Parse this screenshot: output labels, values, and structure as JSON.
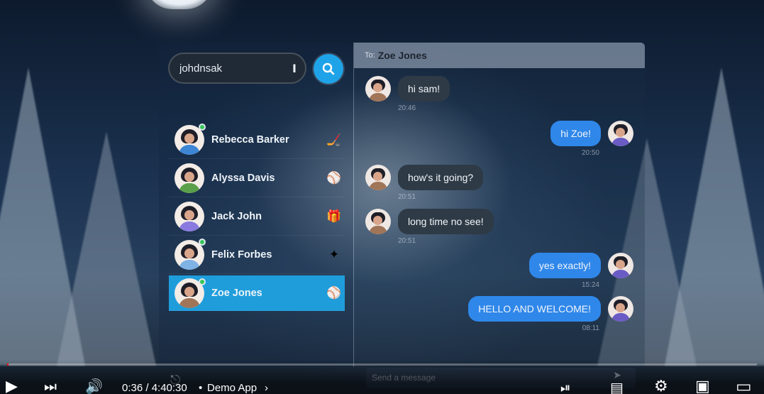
{
  "search": {
    "value": "johdnsak"
  },
  "contacts": [
    {
      "name": "Rebecca Barker",
      "online": true,
      "icon": "hockey-stick-icon",
      "glyph": "🏒",
      "shirt": "#3d86d6"
    },
    {
      "name": "Alyssa Davis",
      "online": false,
      "icon": "baseball-icon",
      "glyph": "⚾",
      "shirt": "#5aa04a"
    },
    {
      "name": "Jack John",
      "online": false,
      "icon": "gift-icon",
      "glyph": "🎁",
      "shirt": "#8a7ae0"
    },
    {
      "name": "Felix Forbes",
      "online": true,
      "icon": "gingerbread-icon",
      "glyph": "✦",
      "shirt": "#7fb2e5"
    },
    {
      "name": "Zoe Jones",
      "online": true,
      "icon": "baseball-icon",
      "glyph": "⚾",
      "shirt": "#a07558",
      "active": true
    }
  ],
  "chat": {
    "to_label": "To:",
    "to_name": "Zoe Jones",
    "messages": [
      {
        "from": "them",
        "text": "hi sam!",
        "time": "20:46"
      },
      {
        "from": "me",
        "text": "hi Zoe!",
        "time": "20:50"
      },
      {
        "from": "them",
        "text": "how's it going?",
        "time": "20:51"
      },
      {
        "from": "them",
        "text": "long time no see!",
        "time": "20:51"
      },
      {
        "from": "me",
        "text": "yes exactly!",
        "time": "15:24"
      },
      {
        "from": "me",
        "text": "HELLO AND WELCOME!",
        "time": "08:11"
      }
    ],
    "composer_placeholder": "Send a message"
  },
  "player": {
    "time": "0:36 / 4:40:30",
    "chapter": "Demo App",
    "progress": 0.002
  }
}
